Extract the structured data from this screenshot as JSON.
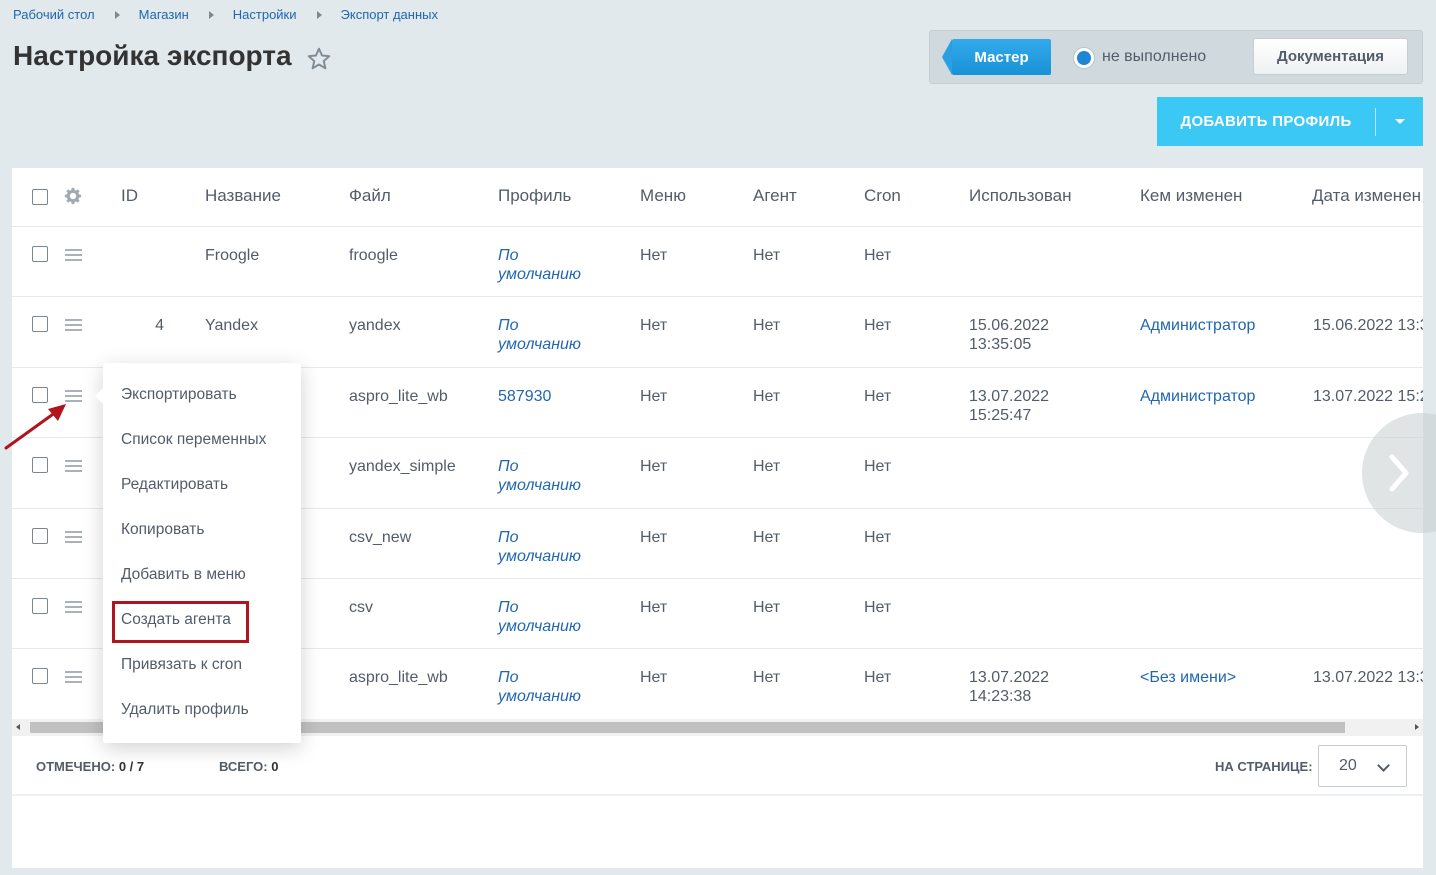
{
  "breadcrumb": [
    "Рабочий стол",
    "Магазин",
    "Настройки",
    "Экспорт данных"
  ],
  "page_title": "Настройка экспорта",
  "wizard": {
    "master_label": "Мастер",
    "status_text": "не выполнено",
    "doc_label": "Документация"
  },
  "add_profile_label": "ДОБАВИТЬ ПРОФИЛЬ",
  "columns": [
    "ID",
    "Название",
    "Файл",
    "Профиль",
    "Меню",
    "Агент",
    "Cron",
    "Использован",
    "Кем изменен",
    "Дата изменен"
  ],
  "rows": [
    {
      "id": "",
      "name": "Froogle",
      "file": "froogle",
      "profile": "По умолчанию",
      "profile_line1": "По",
      "profile_line2": "умолчанию",
      "menu": "Нет",
      "agent": "Нет",
      "cron": "Нет",
      "used_date": "",
      "used_time": "",
      "changed_by": "",
      "changed_date": ""
    },
    {
      "id": "4",
      "name": "Yandex",
      "file": "yandex",
      "profile": "По умолчанию",
      "profile_line1": "По",
      "profile_line2": "умолчанию",
      "menu": "Нет",
      "agent": "Нет",
      "cron": "Нет",
      "used_date": "15.06.2022",
      "used_time": "13:35:05",
      "changed_by": "Администратор",
      "changed_date": "15.06.2022 13:3"
    },
    {
      "id": "",
      "name": "",
      "file": "aspro_lite_wb",
      "profile": "587930",
      "profile_line1": "587930",
      "profile_line2": "",
      "menu": "Нет",
      "agent": "Нет",
      "cron": "Нет",
      "used_date": "13.07.2022",
      "used_time": "15:25:47",
      "changed_by": "Администратор",
      "changed_date": "13.07.2022 15:2"
    },
    {
      "id": "",
      "name": "",
      "file": "yandex_simple",
      "profile": "По умолчанию",
      "profile_line1": "По",
      "profile_line2": "умолчанию",
      "menu": "Нет",
      "agent": "Нет",
      "cron": "Нет",
      "used_date": "",
      "used_time": "",
      "changed_by": "",
      "changed_date": ""
    },
    {
      "id": "",
      "name": "",
      "file": "csv_new",
      "profile": "По умолчанию",
      "profile_line1": "По",
      "profile_line2": "умолчанию",
      "menu": "Нет",
      "agent": "Нет",
      "cron": "Нет",
      "used_date": "",
      "used_time": "",
      "changed_by": "",
      "changed_date": ""
    },
    {
      "id": "",
      "name": "",
      "file": "csv",
      "profile": "По умолчанию",
      "profile_line1": "По",
      "profile_line2": "умолчанию",
      "menu": "Нет",
      "agent": "Нет",
      "cron": "Нет",
      "used_date": "",
      "used_time": "",
      "changed_by": "",
      "changed_date": ""
    },
    {
      "id": "",
      "name": "",
      "file": "aspro_lite_wb",
      "profile": "По умолчанию",
      "profile_line1": "По",
      "profile_line2": "умолчанию",
      "menu": "Нет",
      "agent": "Нет",
      "cron": "Нет",
      "used_date": "13.07.2022",
      "used_time": "14:23:38",
      "changed_by": "<Без имени>",
      "changed_date": "13.07.2022 13:3"
    }
  ],
  "footer": {
    "selected_label": "ОТМЕЧЕНО:",
    "selected_value": "0 / 7",
    "total_label": "ВСЕГО:",
    "total_value": "0",
    "per_page_label": "НА СТРАНИЦЕ:",
    "per_page_value": "20"
  },
  "context_menu": [
    "Экспортировать",
    "Список переменных",
    "Редактировать",
    "Копировать",
    "Добавить в меню",
    "Создать агента",
    "Привязать к cron",
    "Удалить профиль"
  ],
  "colors": {
    "accent": "#3bc8f5",
    "link": "#2067b0",
    "highlight": "#b0141e"
  },
  "icons": [
    "star-icon",
    "gear-icon",
    "menu-icon",
    "chevron-down-icon",
    "chevron-right-icon"
  ]
}
